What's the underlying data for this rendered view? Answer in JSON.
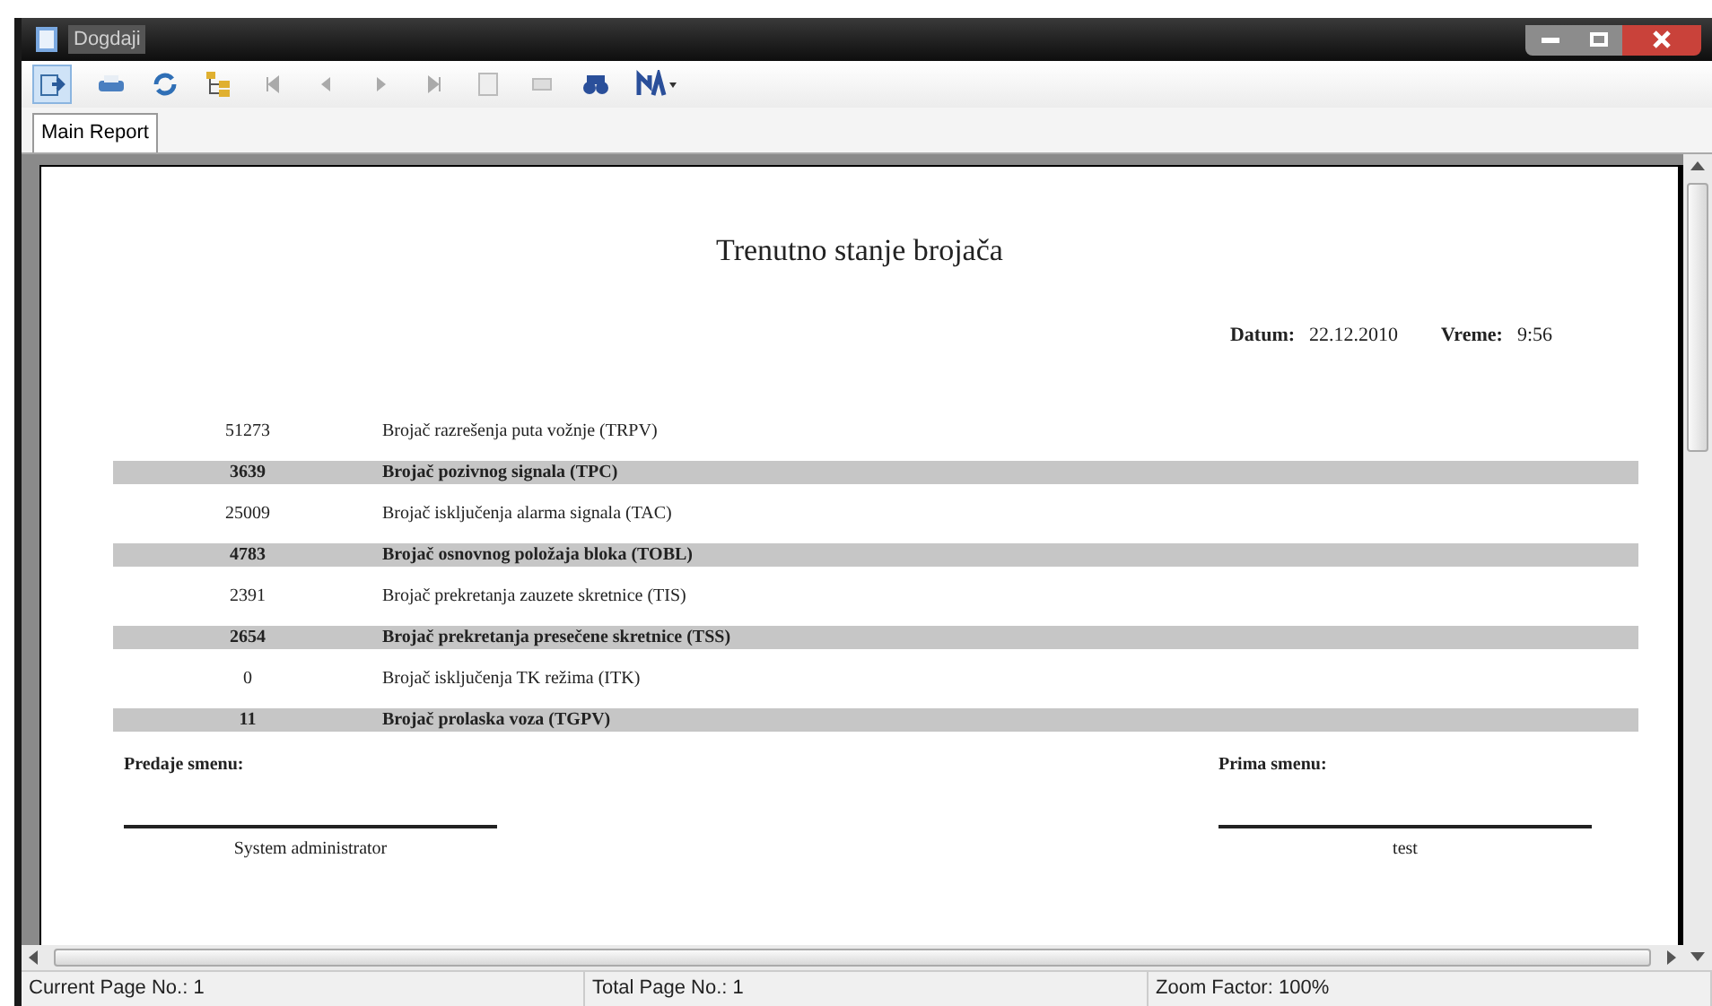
{
  "window": {
    "title": "Dogdaji"
  },
  "tabs": [
    {
      "label": "Main Report",
      "selected": true
    }
  ],
  "report": {
    "title": "Trenutno stanje brojača",
    "date_label": "Datum:",
    "date": "22.12.2010",
    "time_label": "Vreme:",
    "time": "9:56",
    "rows": [
      {
        "count": "51273",
        "name": "Brojač razrešenja puta vožnje (TRPV)",
        "shaded": false
      },
      {
        "count": "3639",
        "name": "Brojač pozivnog signala (TPC)",
        "shaded": true
      },
      {
        "count": "25009",
        "name": "Brojač isključenja alarma signala (TAC)",
        "shaded": false
      },
      {
        "count": "4783",
        "name": "Brojač osnovnog položaja bloka (TOBL)",
        "shaded": true
      },
      {
        "count": "2391",
        "name": "Brojač prekretanja zauzete skretnice (TIS)",
        "shaded": false
      },
      {
        "count": "2654",
        "name": "Brojač prekretanja presečene skretnice (TSS)",
        "shaded": true
      },
      {
        "count": "0",
        "name": "Brojač isključenja TK režima (ITK)",
        "shaded": false
      },
      {
        "count": "11",
        "name": "Brojač prolaska voza (TGPV)",
        "shaded": true
      }
    ],
    "handover_label": "Predaje smenu:",
    "handover_name": "System administrator",
    "receiver_label": "Prima smenu:",
    "receiver_name": "test"
  },
  "status_bar": [
    "Current Page No.: 1",
    "Total Page No.: 1",
    "Zoom Factor: 100%"
  ]
}
